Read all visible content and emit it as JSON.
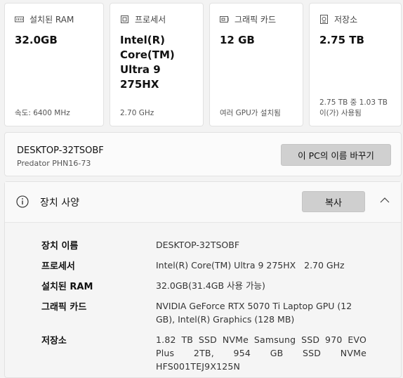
{
  "cards": {
    "ram": {
      "title": "설치된 RAM",
      "value": "32.0GB",
      "sub": "속도: 6400 MHz",
      "icon": "ram-icon"
    },
    "cpu": {
      "title": "프로세서",
      "value": "Intel(R) Core(TM) Ultra 9 275HX",
      "sub": "2.70 GHz",
      "icon": "processor-icon"
    },
    "gpu": {
      "title": "그래픽 카드",
      "value": "12 GB",
      "sub": "여러 GPU가 설치됨",
      "icon": "graphics-card-icon"
    },
    "storage": {
      "title": "저장소",
      "value": "2.75 TB",
      "sub": "2.75 TB 중 1.03 TB 이(가) 사용됨",
      "icon": "storage-icon"
    }
  },
  "pc": {
    "name": "DESKTOP-32TSOBF",
    "model": "Predator PHN16-73",
    "rename_label": "이 PC의 이름 바꾸기"
  },
  "specs": {
    "title": "장치 사양",
    "copy_label": "복사",
    "rows": [
      {
        "label": "장치 이름",
        "value": "DESKTOP-32TSOBF"
      },
      {
        "label": "프로세서",
        "value": "Intel(R) Core(TM) Ultra 9 275HX   2.70 GHz"
      },
      {
        "label": "설치된 RAM",
        "value": "32.0GB(31.4GB 사용 가능)"
      },
      {
        "label": "그래픽 카드",
        "value": "NVIDIA GeForce RTX 5070 Ti Laptop GPU (12 GB), Intel(R) Graphics (128 MB)"
      },
      {
        "label": "저장소",
        "value": "1.82 TB SSD NVMe Samsung SSD 970 EVO Plus 2TB, 954 GB SSD NVMe HFS001TEJ9X125N"
      }
    ]
  }
}
